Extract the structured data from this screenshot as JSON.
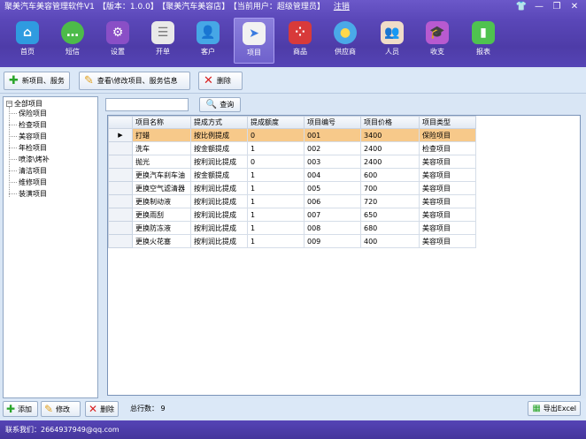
{
  "titlebar": {
    "app_name": "聚美汽车美容管理软件V1",
    "version": "【版本：1.0.0】",
    "shop": "【聚美汽车美容店】",
    "current_user": "【当前用户：超级管理员】",
    "logout": "注销"
  },
  "nav": [
    {
      "label": "首页",
      "icon": "home-icon",
      "color": "#2f9be0"
    },
    {
      "label": "短信",
      "icon": "chat-icon",
      "color": "#4dbb4a"
    },
    {
      "label": "设置",
      "icon": "gear-icon",
      "color": "#8a4fc6"
    },
    {
      "label": "开单",
      "icon": "list-icon",
      "color": "#e9e9e9"
    },
    {
      "label": "客户",
      "icon": "user-icon",
      "color": "#46a7e6"
    },
    {
      "label": "项目",
      "icon": "send-icon",
      "color": "#f2f2f2"
    },
    {
      "label": "商品",
      "icon": "dots-icon",
      "color": "#d83a3a"
    },
    {
      "label": "供应商",
      "icon": "sun-icon",
      "color": "#4aa9e8"
    },
    {
      "label": "人员",
      "icon": "people-icon",
      "color": "#f0dcc8"
    },
    {
      "label": "收支",
      "icon": "cap-icon",
      "color": "#b85ad0"
    },
    {
      "label": "报表",
      "icon": "chart-icon",
      "color": "#4fc24f"
    }
  ],
  "toolbar": {
    "new_label": "新项目、服务",
    "edit_label": "查看\\修改项目、服务信息",
    "delete_label": "删除"
  },
  "tree": {
    "root": "全部项目",
    "children": [
      "保险项目",
      "检查项目",
      "美容项目",
      "年检项目",
      "喷漆\\烤补",
      "清洁项目",
      "维修项目",
      "装潢项目"
    ]
  },
  "search": {
    "value": "",
    "button_label": "查询"
  },
  "grid": {
    "columns": [
      "项目名称",
      "提成方式",
      "提成额度",
      "项目编号",
      "项目价格",
      "项目类型"
    ],
    "rows": [
      [
        "打蜡",
        "按比例提成",
        "0",
        "001",
        "3400",
        "保险项目"
      ],
      [
        "洗车",
        "按金额提成",
        "1",
        "002",
        "2400",
        "检查项目"
      ],
      [
        "抛光",
        "按利润比提成",
        "0",
        "003",
        "2400",
        "美容项目"
      ],
      [
        "更换汽车刹车油",
        "按金额提成",
        "1",
        "004",
        "600",
        "美容项目"
      ],
      [
        "更换空气滤清器",
        "按利润比提成",
        "1",
        "005",
        "700",
        "美容项目"
      ],
      [
        "更换制动液",
        "按利润比提成",
        "1",
        "006",
        "720",
        "美容项目"
      ],
      [
        "更换雨刮",
        "按利润比提成",
        "1",
        "007",
        "650",
        "美容项目"
      ],
      [
        "更换防冻液",
        "按利润比提成",
        "1",
        "008",
        "680",
        "美容项目"
      ],
      [
        "更换火花塞",
        "按利润比提成",
        "1",
        "009",
        "400",
        "美容项目"
      ]
    ],
    "selected_row_marker": "▶"
  },
  "bottom": {
    "add_label": "添加",
    "edit_label": "修改",
    "delete_label": "删除",
    "row_count_label": "总行数：",
    "row_count": "9",
    "export_label": "导出Excel"
  },
  "status": {
    "contact": "联系我们：2664937949@qq.com"
  }
}
